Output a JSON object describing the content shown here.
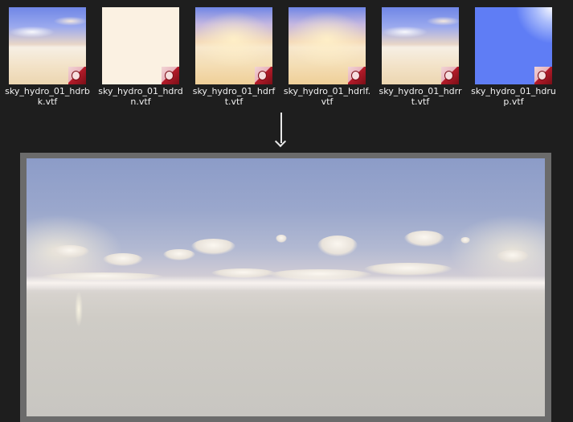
{
  "thumbnails": [
    {
      "filename": "sky_hydro_01_hdrbk.vtf",
      "face": "bk"
    },
    {
      "filename": "sky_hydro_01_hdrdn.vtf",
      "face": "dn"
    },
    {
      "filename": "sky_hydro_01_hdrft.vtf",
      "face": "ft"
    },
    {
      "filename": "sky_hydro_01_hdrlf.vtf",
      "face": "lf"
    },
    {
      "filename": "sky_hydro_01_hdrrt.vtf",
      "face": "rt"
    },
    {
      "filename": "sky_hydro_01_hdrup.vtf",
      "face": "up"
    }
  ],
  "arrow_icon": "down-arrow",
  "preview_icon": "panorama-image",
  "colors": {
    "background": "#1e1e1e",
    "frame": "#6b6b6b",
    "text": "#f0f0f0"
  }
}
